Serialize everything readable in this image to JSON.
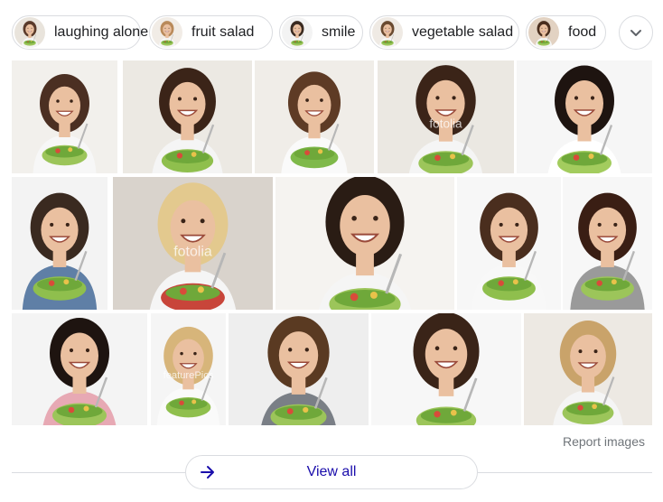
{
  "chips": [
    {
      "label": "laughing alone",
      "thumb_bg": "#e9e4dc",
      "hair": "#5a3a2a"
    },
    {
      "label": "fruit salad",
      "thumb_bg": "#f1ece6",
      "hair": "#b98a5a"
    },
    {
      "label": "smile",
      "thumb_bg": "#f3f3f3",
      "hair": "#3a2a20"
    },
    {
      "label": "vegetable salad",
      "thumb_bg": "#efeae4",
      "hair": "#6a4a30"
    },
    {
      "label": "food",
      "thumb_bg": "#e2d2c2",
      "hair": "#4a2e1e"
    }
  ],
  "expand_icon": "chevron-down-icon",
  "images": [
    {
      "name": "woman-laughing-salad-1",
      "bg": "#f2f0ec",
      "hair": "#4b2f22",
      "shirt": "#f7f7f7",
      "bowl": "#9cc55a",
      "watermark": ""
    },
    {
      "name": "woman-kitchen-salad-1",
      "bg": "#ece9e3",
      "hair": "#3b2418",
      "shirt": "#f5f5f5",
      "bowl": "#8fbf4d",
      "watermark": ""
    },
    {
      "name": "woman-smiling-salad-1",
      "bg": "#f0ede8",
      "hair": "#5e3b25",
      "shirt": "#fafafa",
      "bowl": "#7fb94a",
      "watermark": ""
    },
    {
      "name": "woman-laughing-salad-2",
      "bg": "#ebe8e2",
      "hair": "#3b2418",
      "shirt": "#f5f5f5",
      "bowl": "#9cc55a",
      "watermark": "fotolia"
    },
    {
      "name": "woman-smiling-salad-2",
      "bg": "#f6f6f6",
      "hair": "#1e1410",
      "shirt": "#ffffff",
      "bowl": "#a3cc5e",
      "watermark": ""
    },
    {
      "name": "man-smiling-salad",
      "bg": "#f3f3f3",
      "hair": "#3a2a20",
      "shirt": "#5f7fa6",
      "bowl": "#8fbf4d",
      "watermark": ""
    },
    {
      "name": "woman-blonde-laughing",
      "bg": "#d9d3cc",
      "hair": "#e3c98e",
      "shirt": "#f5f5f5",
      "bowl": "#c8453a",
      "watermark": "fotolia"
    },
    {
      "name": "woman-lying-salad",
      "bg": "#f5f3f0",
      "hair": "#2a1c14",
      "shirt": "#f5f5f5",
      "bowl": "#9cc55a",
      "watermark": ""
    },
    {
      "name": "woman-holding-salad",
      "bg": "#f7f7f7",
      "hair": "#4a2e1e",
      "shirt": "#f8f8f8",
      "bowl": "#8fbf4d",
      "watermark": ""
    },
    {
      "name": "woman-grey-shirt-salad",
      "bg": "#f7f7f7",
      "hair": "#3a1e14",
      "shirt": "#9a9a9a",
      "bowl": "#9cc55a",
      "watermark": ""
    },
    {
      "name": "woman-pink-shirt-salad",
      "bg": "#f4f4f4",
      "hair": "#1e1410",
      "shirt": "#e7a9b4",
      "bowl": "#9cc55a",
      "watermark": ""
    },
    {
      "name": "woman-blonde-salad",
      "bg": "#f5f5f5",
      "hair": "#d7b57a",
      "shirt": "#fafafa",
      "bowl": "#8fbf4d",
      "watermark": "featurePics"
    },
    {
      "name": "woman-thinking-salad",
      "bg": "#eeeeee",
      "hair": "#5a3a22",
      "shirt": "#7a7f86",
      "bowl": "#9cc55a",
      "watermark": ""
    },
    {
      "name": "woman-fork-salad",
      "bg": "#f7f7f7",
      "hair": "#3a2418",
      "shirt": "#f7f7f7",
      "bowl": "#9cc55a",
      "watermark": ""
    },
    {
      "name": "woman-laughing-bowl",
      "bg": "#ede9e3",
      "hair": "#c9a36a",
      "shirt": "#f5f5f5",
      "bowl": "#9cc55a",
      "watermark": ""
    }
  ],
  "report_label": "Report images",
  "view_all_label": "View all",
  "colors": {
    "chip_border": "#dadce0",
    "link": "#1a0dab",
    "muted": "#70757a",
    "skin": "#eac0a0"
  }
}
